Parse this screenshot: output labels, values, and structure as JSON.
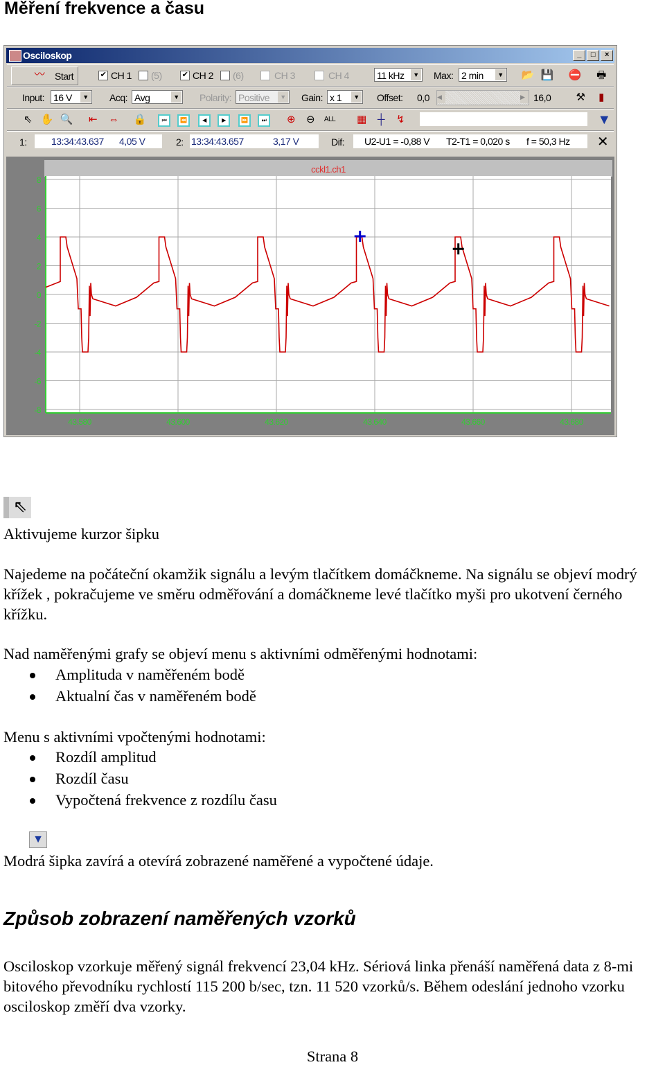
{
  "heading": "Měření frekvence a času",
  "window": {
    "title": "Osciloskop",
    "minimize": "_",
    "maximize": "□",
    "close": "×"
  },
  "toolbar1": {
    "start": "Start",
    "ch1": "CH 1",
    "ch5": "(5)",
    "ch2": "CH 2",
    "ch6": "(6)",
    "ch3": "CH 3",
    "ch4": "CH 4",
    "rate": "11 kHz",
    "max_label": "Max:",
    "max_value": "2 min",
    "ch1_checked": true,
    "ch2_checked": true
  },
  "toolbar2": {
    "input_label": "Input:",
    "input_value": "16 V",
    "acq_label": "Acq:",
    "acq_value": "Avg",
    "polarity_label": "Polarity:",
    "polarity_value": "Positive",
    "gain_label": "Gain:",
    "gain_value": "x 1",
    "offset_label": "Offset:",
    "offset_min": "0,0",
    "offset_max": "16,0"
  },
  "readout": {
    "c1_label": "1:",
    "c1_time": "13:34:43.637",
    "c1_volt": "4,05 V",
    "c2_label": "2:",
    "c2_time": "13:34:43.657",
    "c2_volt": "3,17 V",
    "dif_label": "Dif:",
    "du": "U2-U1 = -0,88 V",
    "dt": "T2-T1 = 0,020 s",
    "freq": "f = 50,3 Hz"
  },
  "plot": {
    "title": "cckl1.ch1",
    "y_ticks": [
      "8",
      "6",
      "4",
      "2",
      "0",
      "-2",
      "-4",
      "-6",
      "-8"
    ],
    "x_ticks": [
      "43.580",
      "43.600",
      "43.620",
      "43.640",
      "43.660",
      "43.680"
    ],
    "trace_color": "#cc0000",
    "axis_color": "#33cc33",
    "cursor1": {
      "t": "43.637",
      "v": 4.05,
      "color": "#0000cc"
    },
    "cursor2": {
      "t": "43.657",
      "v": 3.17,
      "color": "#000000"
    }
  },
  "doc": {
    "p1": "Aktivujeme kurzor šipku",
    "p2": "Najedeme na počáteční okamžik signálu a levým tlačítkem domáčkneme. Na signálu se objeví modrý křížek , pokračujeme ve směru odměřování a domáčkneme levé tlačítko myši pro ukotvení černého křížku.",
    "p3": "Nad naměřenými grafy se objeví menu s aktivními odměřenými hodnotami:",
    "list1": [
      "Amplituda v naměřeném bodě",
      "Aktualní čas v naměřeném bodě"
    ],
    "p4": "Menu s aktivními vpočtenými hodnotami:",
    "list2": [
      "Rozdíl amplitud",
      "Rozdíl času",
      "Vypočtená frekvence z rozdílu času"
    ],
    "p5": "Modrá šipka zavírá a otevírá zobrazené naměřené a vypočtené údaje.",
    "h2": "Způsob zobrazení naměřených vzorků",
    "p6": "Osciloskop vzorkuje měřený signál  frekvencí 23,04 kHz. Sériová linka přenáší naměřená data z 8-mi bitového převodníku rychlostí 115 200 b/sec, tzn. 11 520 vzorků/s. Během odeslání jednoho vzorku osciloskop změří dva vzorky.",
    "footer": "Strana 8"
  }
}
